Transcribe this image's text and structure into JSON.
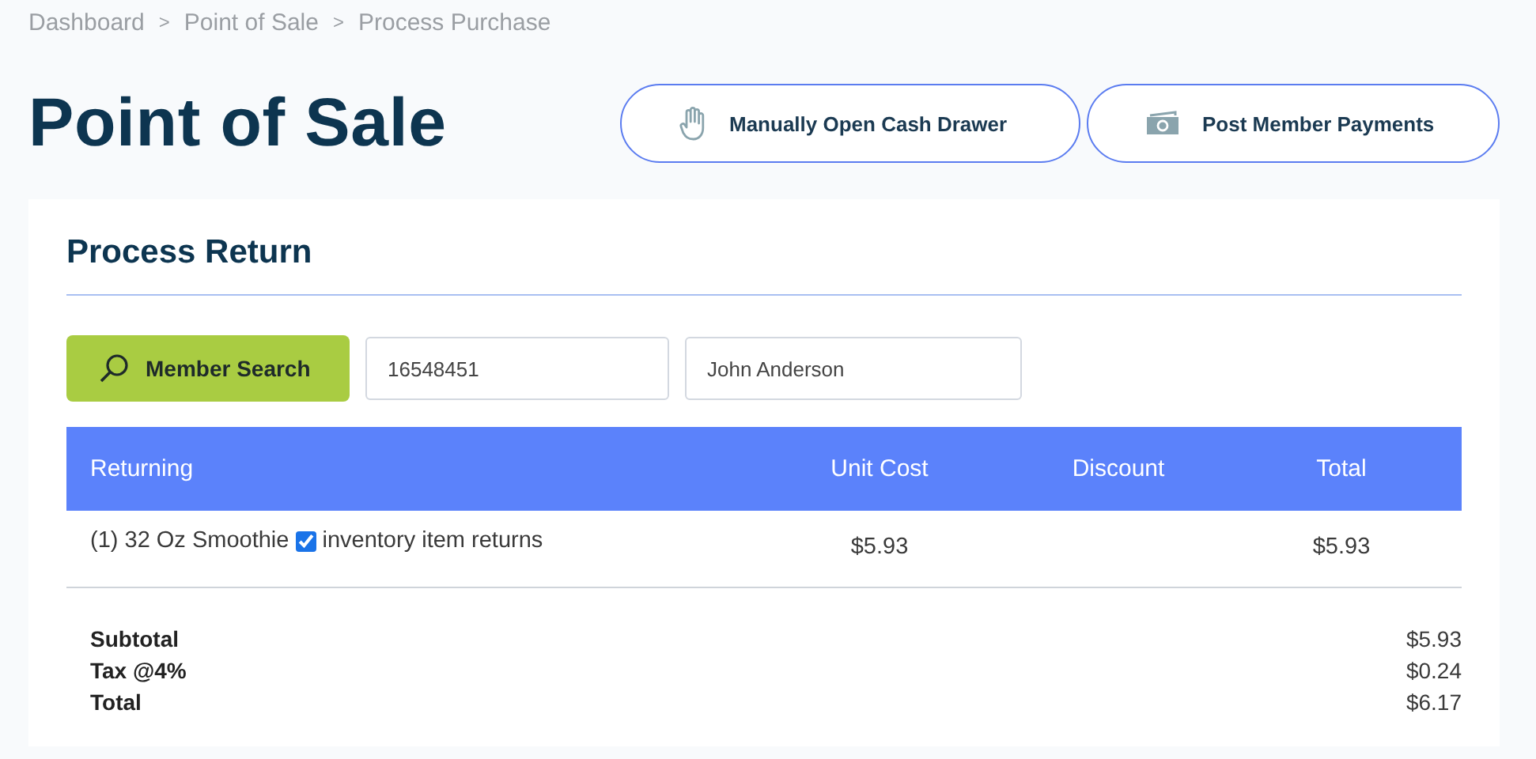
{
  "breadcrumb": {
    "items": [
      "Dashboard",
      "Point of Sale",
      "Process Purchase"
    ],
    "separators": [
      ">",
      ">"
    ]
  },
  "page_title": "Point of Sale",
  "header_buttons": [
    {
      "label": "Manually Open Cash Drawer",
      "kind": "hand"
    },
    {
      "label": "Post Member Payments",
      "kind": "money"
    }
  ],
  "card": {
    "title": "Process Return",
    "search_button": "Member Search",
    "fields": [
      {
        "value": "16548451"
      },
      {
        "value": "John Anderson"
      }
    ],
    "table": {
      "columns": [
        "Returning",
        "Unit Cost",
        "Discount",
        "Total"
      ],
      "rows": [
        {
          "item": "(1) 32 Oz Smoothie",
          "checked": true,
          "check_label": "inventory item returns",
          "unit_cost": "$5.93",
          "total": "$5.93"
        }
      ]
    },
    "totals": [
      {
        "label": "Subtotal",
        "value": "$5.93"
      },
      {
        "label": "Tax @4%",
        "value": "$0.24"
      },
      {
        "label": "Total",
        "value": "$6.17"
      }
    ]
  }
}
